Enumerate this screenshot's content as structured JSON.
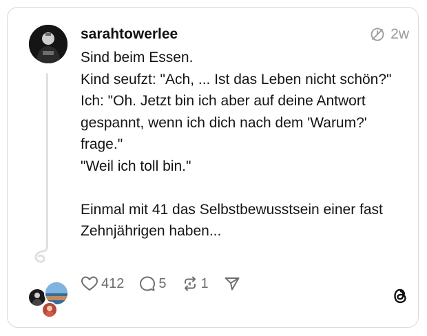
{
  "post": {
    "username": "sarahtowerlee",
    "time": "2w",
    "lines": [
      "Sind beim Essen.",
      "Kind seufzt: \"Ach, ... Ist das Leben nicht schön?\"",
      "Ich: \"Oh. Jetzt bin ich aber auf deine Antwort gespannt, wenn ich dich nach dem 'Warum?' frage.\"",
      "\"Weil ich toll bin.\"",
      "",
      "Einmal mit 41 das Selbstbewusstsein einer fast Zehnjährigen haben..."
    ]
  },
  "actions": {
    "likes": "412",
    "replies": "5",
    "reposts": "1"
  },
  "icons": {
    "meta": "edited-clock-icon",
    "like": "heart-icon",
    "reply": "comment-icon",
    "repost": "repost-icon",
    "share": "send-icon",
    "brand": "threads-logo-icon"
  },
  "colors": {
    "text": "#101010",
    "muted": "#9a9a9a",
    "border": "#d9d9d9"
  }
}
